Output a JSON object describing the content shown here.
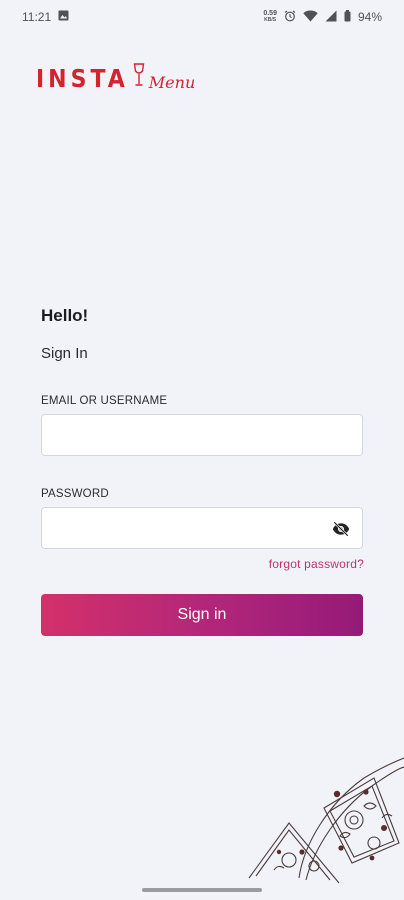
{
  "status_bar": {
    "time": "11:21",
    "net_speed_value": "0.59",
    "net_speed_unit": "KB/S",
    "battery": "94%"
  },
  "logo": {
    "part1": "INSTA",
    "part2": "Menu"
  },
  "form": {
    "greeting": "Hello!",
    "subtitle": "Sign In",
    "email_label": "EMAIL OR USERNAME",
    "email_value": "",
    "password_label": "PASSWORD",
    "password_value": "",
    "forgot_label": "forgot password?",
    "submit_label": "Sign in"
  },
  "colors": {
    "accent": "#c2326a",
    "button_gradient_start": "#d4306a",
    "button_gradient_end": "#951a78",
    "logo_red": "#d3232f",
    "background": "#f2f3f8"
  }
}
